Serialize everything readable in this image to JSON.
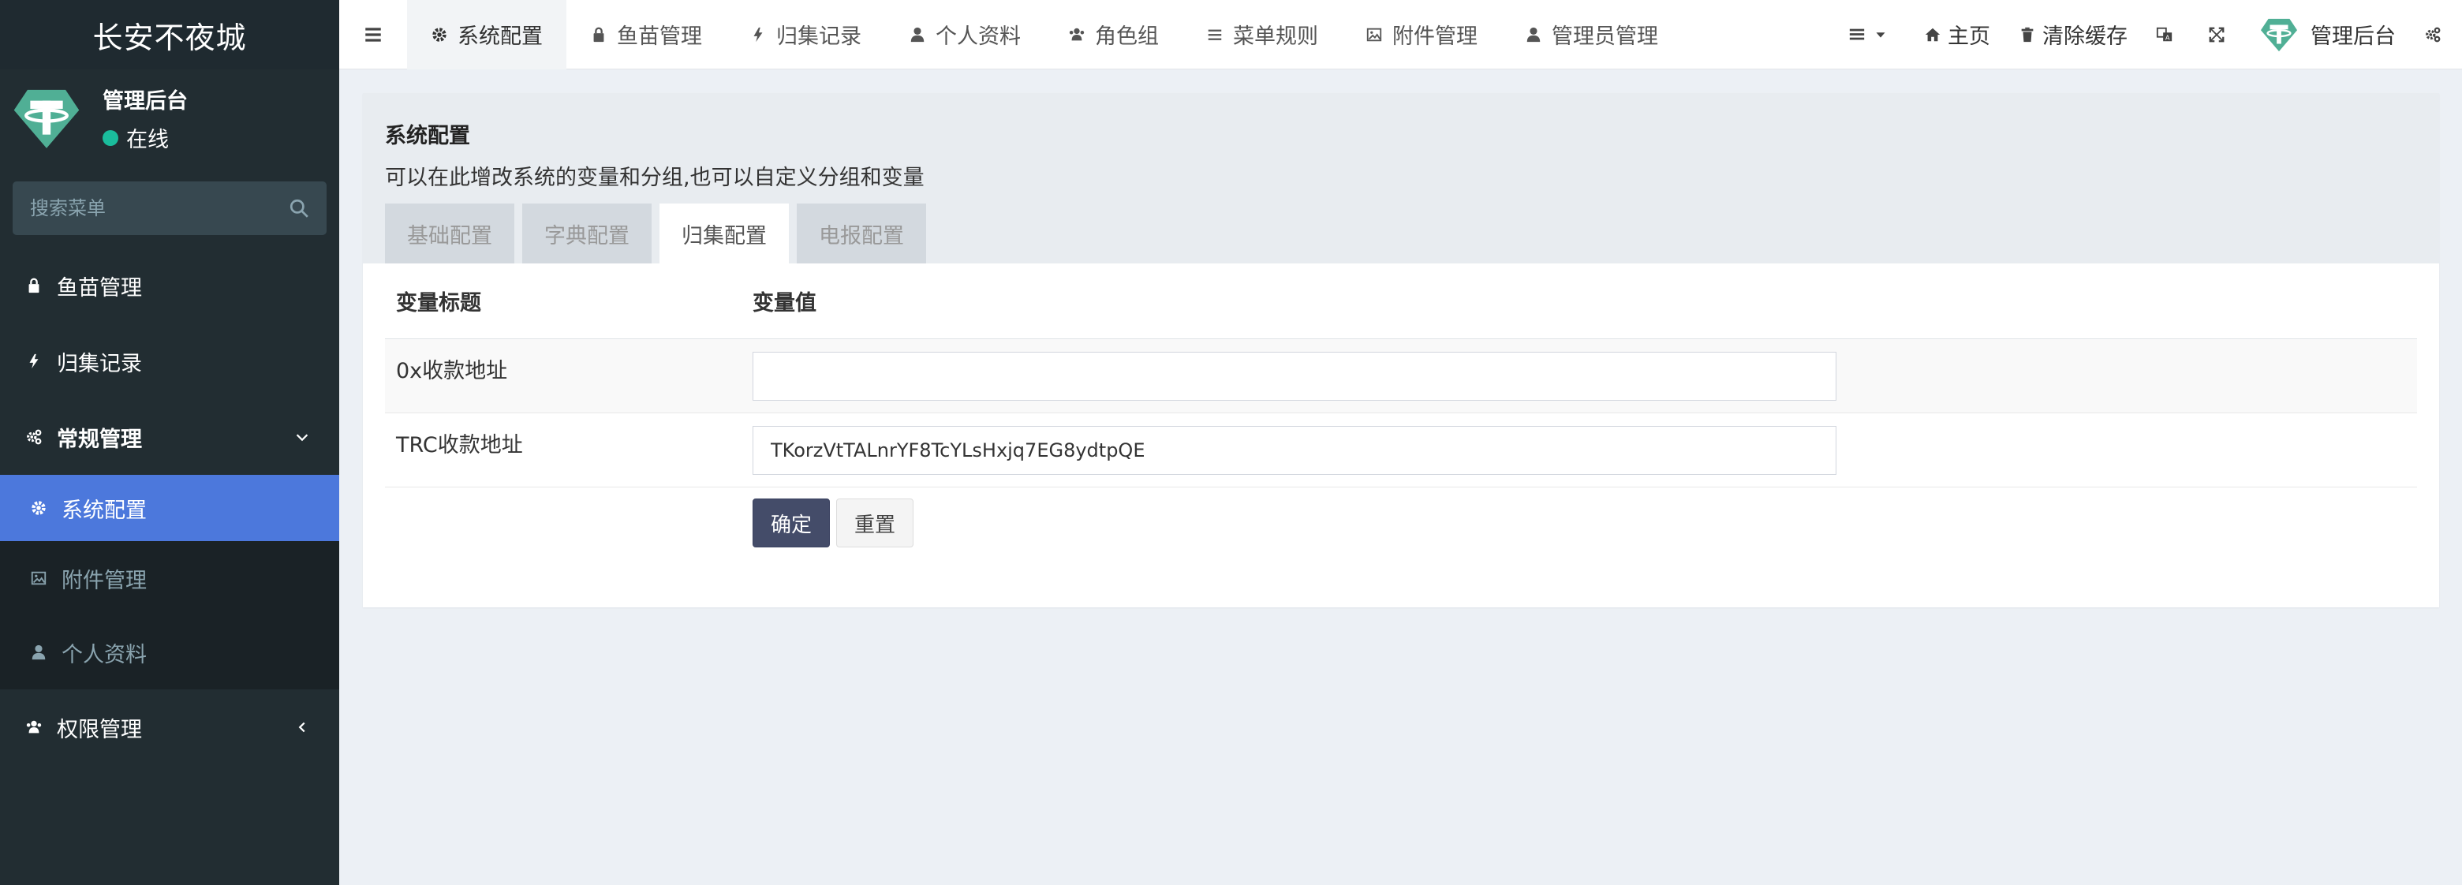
{
  "app": {
    "logo_text": "长安不夜城",
    "brand_color": "#3c8dbc",
    "sidebar_bg": "#222d32",
    "active_color": "#4c78dc"
  },
  "user_panel": {
    "name": "管理后台",
    "status": "在线",
    "status_color": "#1abc9c"
  },
  "search": {
    "placeholder": "搜索菜单",
    "icon": "search-icon"
  },
  "sidebar": {
    "items": [
      {
        "label": "鱼苗管理",
        "icon": "lock-icon"
      },
      {
        "label": "归集记录",
        "icon": "bolt-icon"
      },
      {
        "label": "常规管理",
        "icon": "cogs-icon"
      },
      {
        "label": "权限管理",
        "icon": "users-icon"
      }
    ],
    "submenu": [
      {
        "label": "系统配置",
        "icon": "gear-icon",
        "active": true
      },
      {
        "label": "附件管理",
        "icon": "image-icon"
      },
      {
        "label": "个人资料",
        "icon": "user-icon"
      }
    ]
  },
  "topnav": {
    "tabs": [
      {
        "label": "系统配置",
        "icon": "gear-icon",
        "active": true
      },
      {
        "label": "鱼苗管理",
        "icon": "lock-icon"
      },
      {
        "label": "归集记录",
        "icon": "bolt-icon"
      },
      {
        "label": "个人资料",
        "icon": "user-icon"
      },
      {
        "label": "角色组",
        "icon": "users-icon"
      },
      {
        "label": "菜单规则",
        "icon": "bars-icon"
      },
      {
        "label": "附件管理",
        "icon": "image-icon"
      },
      {
        "label": "管理员管理",
        "icon": "user-icon"
      }
    ],
    "home_label": "主页",
    "clear_cache_label": "清除缓存",
    "admin_label": "管理后台"
  },
  "panel": {
    "title": "系统配置",
    "description": "可以在此增改系统的变量和分组,也可以自定义分组和变量",
    "tabs": [
      {
        "label": "基础配置"
      },
      {
        "label": "字典配置"
      },
      {
        "label": "归集配置",
        "active": true
      },
      {
        "label": "电报配置"
      }
    ],
    "table": {
      "header_title": "变量标题",
      "header_value": "变量值",
      "rows": [
        {
          "title": "0x收款地址",
          "value": ""
        },
        {
          "title": "TRC收款地址",
          "value": "TKorzVtTALnrYF8TcYLsHxjq7EG8ydtpQE"
        }
      ]
    },
    "confirm_label": "确定",
    "reset_label": "重置"
  }
}
